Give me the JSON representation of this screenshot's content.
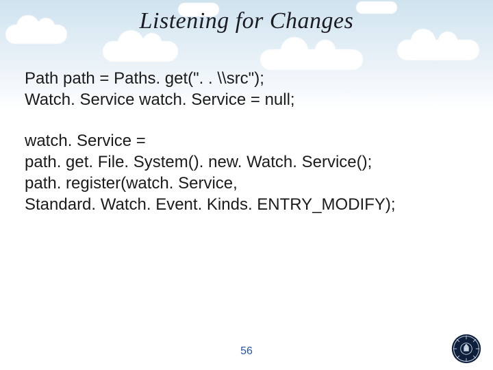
{
  "title": "Listening for Changes",
  "code": {
    "l1": "Path path = Paths. get(\". . \\\\src\");",
    "l2": "Watch. Service watch. Service = null;",
    "l3": "watch. Service =",
    "l4": "path. get. File. System(). new. Watch. Service();",
    "l5": "path. register(watch. Service,",
    "l6": "Standard. Watch. Event. Kinds. ENTRY_MODIFY);"
  },
  "page_number": "56"
}
